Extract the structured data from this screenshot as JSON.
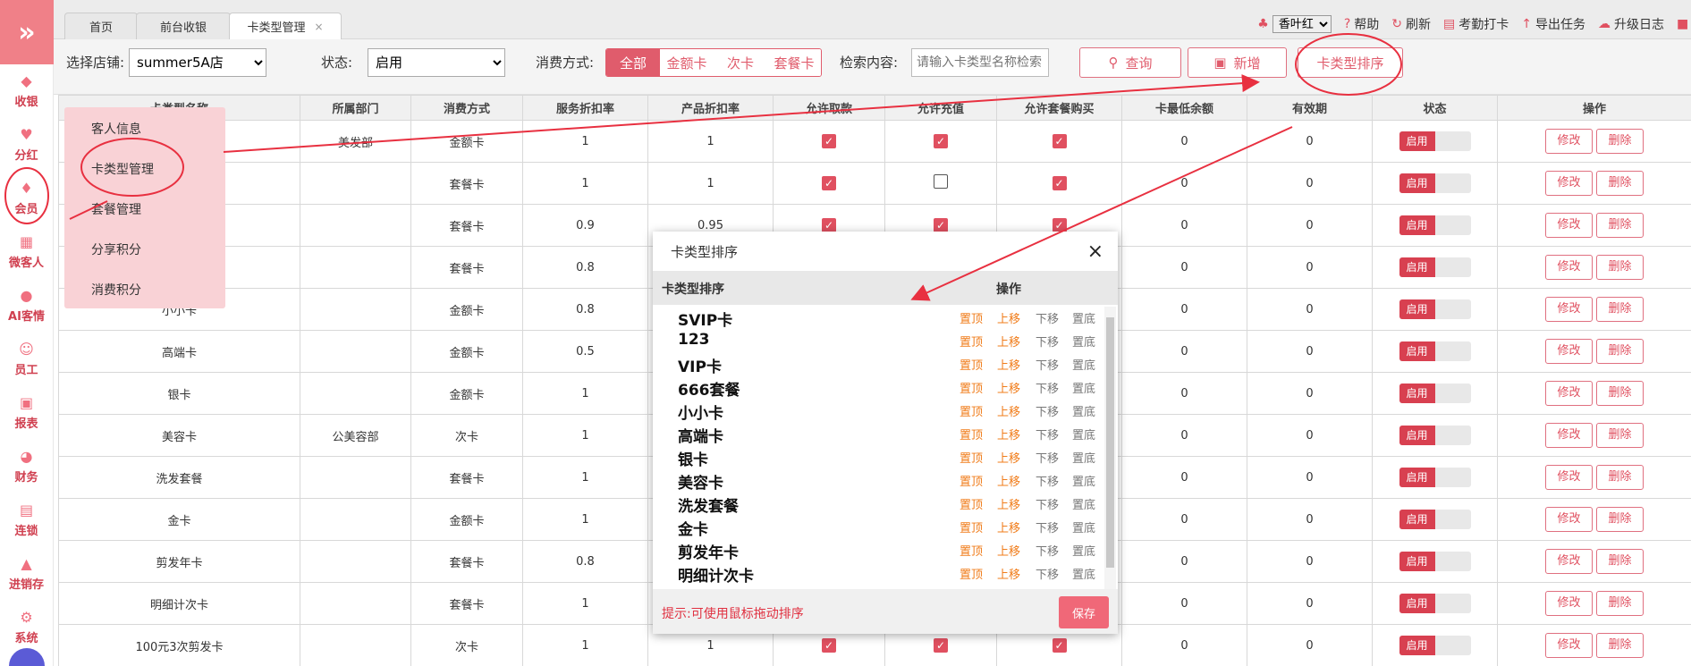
{
  "sidebar": {
    "toggle_icon": "»",
    "items": [
      {
        "label": "收银",
        "icon": "cash-register-icon"
      },
      {
        "label": "分红",
        "icon": "dividend-icon"
      },
      {
        "label": "会员",
        "icon": "diamond-icon"
      },
      {
        "label": "微客人",
        "icon": "grid-icon"
      },
      {
        "label": "AI客情",
        "icon": "ai-icon"
      },
      {
        "label": "员工",
        "icon": "user-icon"
      },
      {
        "label": "报表",
        "icon": "report-icon"
      },
      {
        "label": "财务",
        "icon": "pie-chart-icon"
      },
      {
        "label": "连锁",
        "icon": "store-icon"
      },
      {
        "label": "进销存",
        "icon": "inventory-icon"
      },
      {
        "label": "系统",
        "icon": "gear-icon"
      }
    ]
  },
  "tabs": [
    {
      "label": "首页"
    },
    {
      "label": "前台收银"
    },
    {
      "label": "卡类型管理",
      "close": "×"
    }
  ],
  "topright": {
    "skin": "香叶红",
    "help": "帮助",
    "refresh": "刷新",
    "attendance": "考勤打卡",
    "export": "导出任务",
    "upgrade": "升级日志"
  },
  "filters": {
    "store_label": "选择店铺:",
    "store_value": "summer5A店",
    "status_label": "状态:",
    "status_value": "启用",
    "pay_label": "消费方式:",
    "pay_options": [
      "全部",
      "金额卡",
      "次卡",
      "套餐卡"
    ],
    "search_label": "检索内容:",
    "search_placeholder": "请输入卡类型名称检索",
    "query": "查询",
    "add": "新增",
    "sort": "卡类型排序"
  },
  "table": {
    "headers": [
      "卡类型名称",
      "所属部门",
      "消费方式",
      "服务折扣率",
      "产品折扣率",
      "允许取款",
      "允许充值",
      "允许套餐购买",
      "卡最低余额",
      "有效期",
      "状态",
      "操作"
    ],
    "rows": [
      {
        "name": "",
        "dept": "美发部",
        "pay": "金额卡",
        "svc": "1",
        "prod": "1",
        "a": true,
        "b": true,
        "c": true,
        "min": "0",
        "valid": "0"
      },
      {
        "name": "",
        "dept": "",
        "pay": "套餐卡",
        "svc": "1",
        "prod": "1",
        "a": true,
        "b": false,
        "c": true,
        "min": "0",
        "valid": "0"
      },
      {
        "name": "",
        "dept": "",
        "pay": "套餐卡",
        "svc": "0.9",
        "prod": "0.95",
        "a": true,
        "b": true,
        "c": true,
        "min": "0",
        "valid": "0"
      },
      {
        "name": "",
        "dept": "",
        "pay": "套餐卡",
        "svc": "0.8",
        "prod": "",
        "a": true,
        "b": true,
        "c": true,
        "min": "0",
        "valid": "0"
      },
      {
        "name": "小小卡",
        "dept": "",
        "pay": "金额卡",
        "svc": "0.8",
        "prod": "",
        "a": true,
        "b": true,
        "c": true,
        "min": "0",
        "valid": "0"
      },
      {
        "name": "高端卡",
        "dept": "",
        "pay": "金额卡",
        "svc": "0.5",
        "prod": "",
        "a": true,
        "b": true,
        "c": true,
        "min": "0",
        "valid": "0"
      },
      {
        "name": "银卡",
        "dept": "",
        "pay": "金额卡",
        "svc": "1",
        "prod": "",
        "a": true,
        "b": true,
        "c": true,
        "min": "0",
        "valid": "0"
      },
      {
        "name": "美容卡",
        "dept": "公美容部",
        "pay": "次卡",
        "svc": "1",
        "prod": "",
        "a": true,
        "b": true,
        "c": true,
        "min": "0",
        "valid": "0"
      },
      {
        "name": "洗发套餐",
        "dept": "",
        "pay": "套餐卡",
        "svc": "1",
        "prod": "",
        "a": true,
        "b": true,
        "c": true,
        "min": "0",
        "valid": "0"
      },
      {
        "name": "金卡",
        "dept": "",
        "pay": "金额卡",
        "svc": "1",
        "prod": "",
        "a": true,
        "b": true,
        "c": true,
        "min": "0",
        "valid": "0"
      },
      {
        "name": "剪发年卡",
        "dept": "",
        "pay": "套餐卡",
        "svc": "0.8",
        "prod": "",
        "a": true,
        "b": true,
        "c": true,
        "min": "0",
        "valid": "0"
      },
      {
        "name": "明细计次卡",
        "dept": "",
        "pay": "套餐卡",
        "svc": "1",
        "prod": "",
        "a": true,
        "b": true,
        "c": true,
        "min": "0",
        "valid": "0"
      },
      {
        "name": "100元3次剪发卡",
        "dept": "",
        "pay": "次卡",
        "svc": "1",
        "prod": "1",
        "a": true,
        "b": true,
        "c": true,
        "min": "0",
        "valid": "0"
      }
    ],
    "status_label": "启用",
    "edit": "修改",
    "delete": "删除",
    "check_mark": "✓"
  },
  "menu": {
    "items": [
      "客人信息",
      "卡类型管理",
      "套餐管理",
      "分享积分",
      "消费积分"
    ]
  },
  "dialog": {
    "title": "卡类型排序",
    "close": "×",
    "col_sort": "卡类型排序",
    "col_op": "操作",
    "items": [
      "SVIP卡",
      "123",
      "VIP卡",
      "666套餐",
      "小小卡",
      "高端卡",
      "银卡",
      "美容卡",
      "洗发套餐",
      "金卡",
      "剪发年卡",
      "明细计次卡"
    ],
    "actions": [
      "置顶",
      "上移",
      "下移",
      "置底"
    ],
    "tip": "提示:可使用鼠标拖动排序",
    "save": "保存"
  },
  "colors": {
    "brand": "#e05c6c",
    "menu_bg": "#f9d2d6",
    "action_active": "#f07c1a",
    "action_inactive": "#777777",
    "annotation": "#e83040"
  }
}
